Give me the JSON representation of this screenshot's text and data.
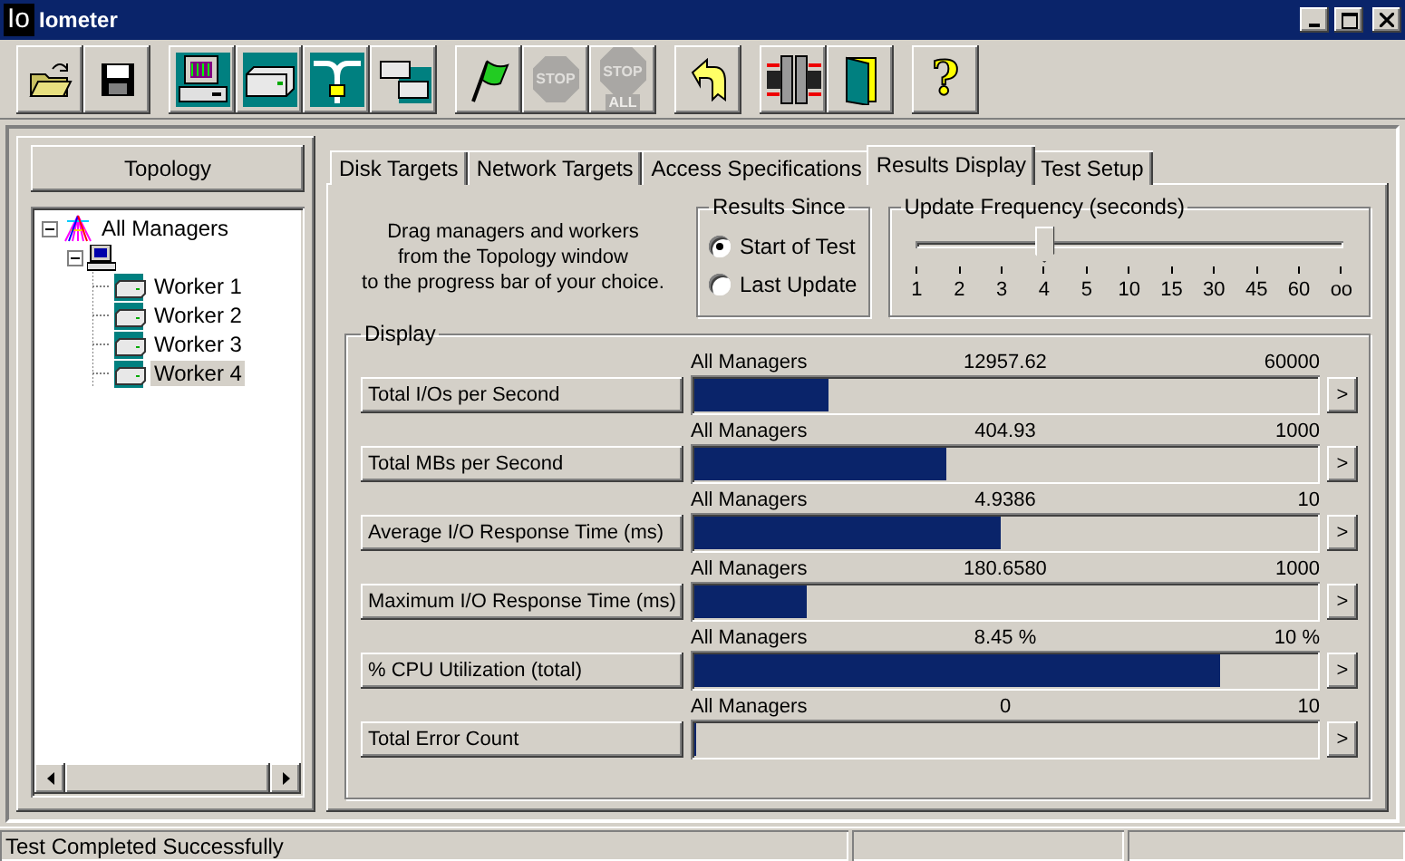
{
  "window": {
    "logo": "Io",
    "title": "Iometer"
  },
  "toolbar": [
    [
      {
        "kind": "open",
        "disabled": false
      },
      {
        "kind": "save",
        "disabled": false
      }
    ],
    [
      {
        "kind": "computer",
        "disabled": false
      },
      {
        "kind": "disk",
        "disabled": false
      },
      {
        "kind": "network",
        "disabled": false
      },
      {
        "kind": "copy",
        "disabled": false
      }
    ],
    [
      {
        "kind": "flag",
        "disabled": false
      },
      {
        "kind": "stop",
        "label": "STOP",
        "disabled": true
      },
      {
        "kind": "stop_all",
        "label": "STOP",
        "sublabel": "ALL",
        "disabled": true
      }
    ],
    [
      {
        "kind": "reset",
        "disabled": false
      }
    ],
    [
      {
        "kind": "disconnect",
        "disabled": false
      },
      {
        "kind": "exit",
        "disabled": false
      }
    ],
    [
      {
        "kind": "help",
        "label": "?",
        "disabled": false
      }
    ]
  ],
  "topology": {
    "title": "Topology",
    "tree": [
      {
        "kind": "all_managers",
        "label": "All Managers",
        "expanded": true,
        "selected": false,
        "children": [
          {
            "kind": "manager",
            "expanded": true,
            "children": [
              {
                "kind": "worker",
                "label": "Worker 1",
                "selected": false
              },
              {
                "kind": "worker",
                "label": "Worker 2",
                "selected": false
              },
              {
                "kind": "worker",
                "label": "Worker 3",
                "selected": false
              },
              {
                "kind": "worker",
                "label": "Worker 4",
                "selected": true
              }
            ]
          }
        ]
      }
    ]
  },
  "tabs": [
    {
      "label": "Disk Targets",
      "selected": false
    },
    {
      "label": "Network Targets",
      "selected": false
    },
    {
      "label": "Access Specifications",
      "selected": false
    },
    {
      "label": "Results Display",
      "selected": true
    },
    {
      "label": "Test Setup",
      "selected": false
    }
  ],
  "hint": "Drag managers and workers\nfrom the Topology window\nto the progress bar of your choice.",
  "results_since": {
    "title": "Results Since",
    "options": [
      {
        "label": "Start of Test",
        "selected": true
      },
      {
        "label": "Last Update",
        "selected": false
      }
    ]
  },
  "update_frequency": {
    "title": "Update Frequency (seconds)",
    "level": 0.3,
    "ticks": [
      "1",
      "2",
      "3",
      "4",
      "5",
      "10",
      "15",
      "30",
      "45",
      "60",
      "oo"
    ]
  },
  "display": {
    "title": "Display",
    "rows": [
      {
        "button": "Total I/Os per Second",
        "target": "All Managers",
        "value": "12957.62",
        "max": "60000",
        "level": 0.216,
        "more": ">"
      },
      {
        "button": "Total MBs per Second",
        "target": "All Managers",
        "value": "404.93",
        "max": "1000",
        "level": 0.405,
        "more": ">"
      },
      {
        "button": "Average I/O Response Time (ms)",
        "target": "All Managers",
        "value": "4.9386",
        "max": "10",
        "level": 0.494,
        "more": ">"
      },
      {
        "button": "Maximum I/O Response Time (ms)",
        "target": "All Managers",
        "value": "180.6580",
        "max": "1000",
        "level": 0.181,
        "more": ">"
      },
      {
        "button": "% CPU Utilization (total)",
        "target": "All Managers",
        "value": "8.45 %",
        "max": "10 %",
        "level": 0.845,
        "more": ">"
      },
      {
        "button": "Total Error Count",
        "target": "All Managers",
        "value": "0",
        "max": "10",
        "level": 0,
        "more": ">"
      }
    ]
  },
  "status_bar": {
    "message": "Test Completed Successfully"
  }
}
